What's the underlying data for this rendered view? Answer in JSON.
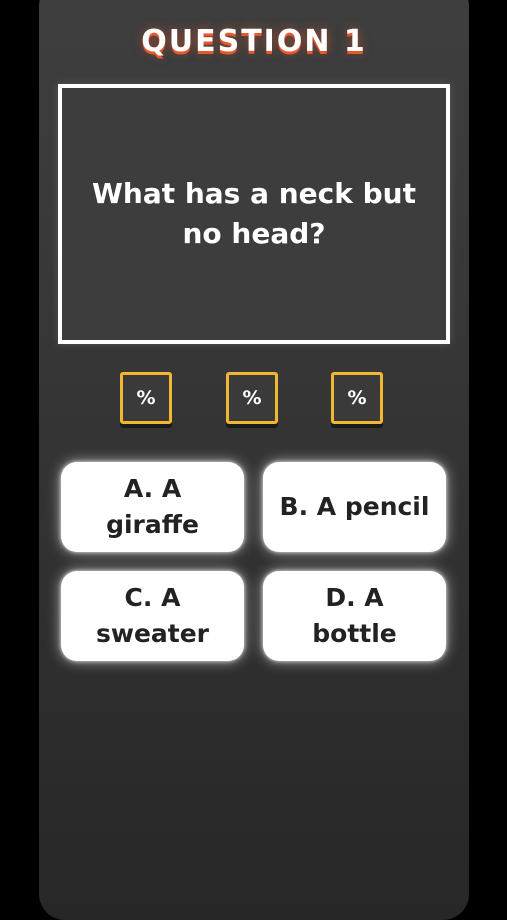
{
  "quiz": {
    "title": "QUESTION 1",
    "question": "What has a neck but no head?",
    "lifelines": [
      {
        "label": "%"
      },
      {
        "label": "%"
      },
      {
        "label": "%"
      }
    ],
    "answers": [
      {
        "line1": "A. A",
        "line2": "giraffe"
      },
      {
        "line1": "B. A pencil",
        "line2": ""
      },
      {
        "line1": "C. A",
        "line2": "sweater"
      },
      {
        "line1": "D. A",
        "line2": "bottle"
      }
    ]
  },
  "colors": {
    "background": "#000000",
    "panel": "#3a3a3a",
    "title_shadow": "#e8572e",
    "lifeline_border": "#f2b632",
    "answer_bg": "#ffffff",
    "answer_text": "#222222"
  },
  "icons": {
    "lifeline": "percent-icon"
  }
}
